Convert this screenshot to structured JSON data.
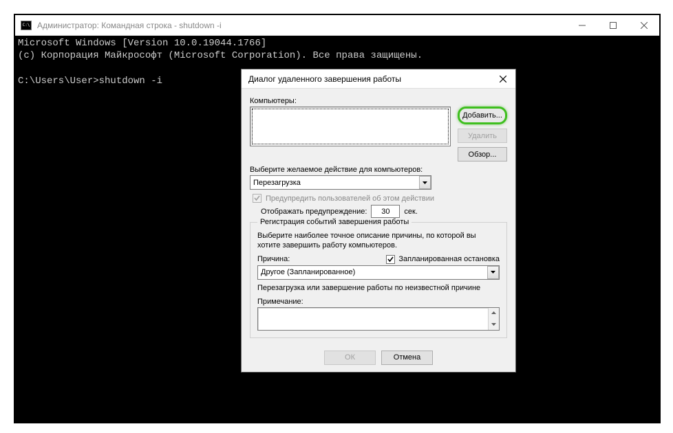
{
  "window": {
    "title": "Администратор: Командная строка - shutdown  -i",
    "console_line1": "Microsoft Windows [Version 10.0.19044.1766]",
    "console_line2": "(c) Корпорация Майкрософт (Microsoft Corporation). Все права защищены.",
    "console_prompt": "C:\\Users\\User>shutdown -i"
  },
  "dialog": {
    "title": "Диалог удаленного завершения работы",
    "computers_label": "Компьютеры:",
    "btn_add": "Добавить...",
    "btn_remove": "Удалить",
    "btn_browse": "Обзор...",
    "action_label": "Выберите желаемое действие для компьютеров:",
    "action_value": "Перезагрузка",
    "warn_check": "Предупредить пользователей об этом действии",
    "warn_label": "Отображать предупреждение:",
    "warn_value": "30",
    "warn_unit": "сек.",
    "fieldset_title": "Регистрация событий завершения работы",
    "fieldset_desc": "Выберите наиболее точное описание причины, по которой вы хотите завершить работу компьютеров.",
    "reason_label": "Причина:",
    "planned_label": "Запланированная остановка",
    "reason_value": "Другое (Запланированное)",
    "restart_desc": "Перезагрузка или завершение работы по неизвестной причине",
    "note_label": "Примечание:",
    "btn_ok": "ОК",
    "btn_cancel": "Отмена"
  }
}
